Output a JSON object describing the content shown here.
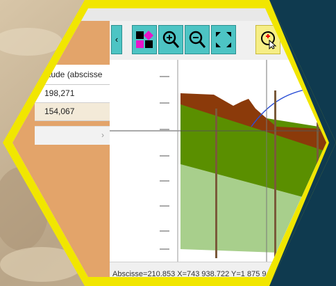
{
  "table": {
    "header": "titude (abscisse",
    "rows": [
      "198,271",
      "154,067"
    ],
    "scroll_arrow": "›"
  },
  "toolbar": {
    "collapse_glyph": "‹",
    "buttons": [
      {
        "name": "layers-icon"
      },
      {
        "name": "zoom-in-icon"
      },
      {
        "name": "zoom-out-icon"
      },
      {
        "name": "fit-extent-icon"
      },
      {
        "name": "pick-point-icon"
      }
    ]
  },
  "status": {
    "text": "Abscisse=210.853  X=743 938.722  Y=1 875 9"
  },
  "colors": {
    "accent_teal": "#4dc4c4",
    "dark_green": "#5a8f00",
    "light_green": "#a8cf8c",
    "brown": "#8b3a0a",
    "navy": "#0f3a4f",
    "hex_yellow": "#f1e600",
    "panel_orange": "#e3a46a"
  }
}
